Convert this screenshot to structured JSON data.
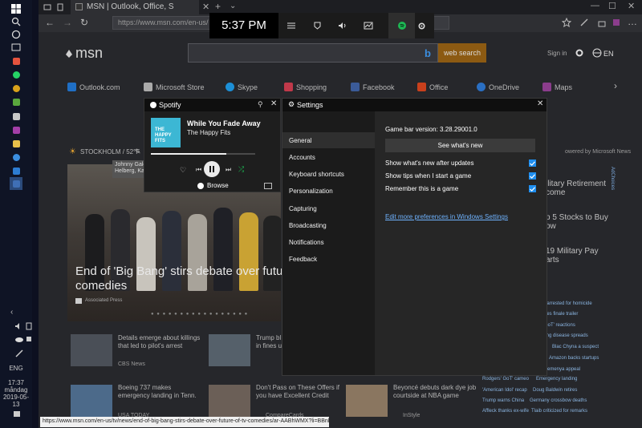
{
  "taskbar": {
    "language": "ENG",
    "time": "17:37",
    "day": "måndag",
    "date": "2019-05-13"
  },
  "browser": {
    "tab_title": "MSN | Outlook, Office, S",
    "address": "https://www.msn.com/en-us/",
    "status_url": "https://www.msn.com/en-us/tv/news/end-of-big-bang-stirs-debate-over-future-of-tv-comedies/ar-AABhWMX?li=BBnb7Kz"
  },
  "msn": {
    "logo": "msn",
    "search_button": "web search",
    "signin": "Sign in",
    "locale": "EN",
    "nav": [
      "Outlook.com",
      "Microsoft Store",
      "Skype",
      "Shopping",
      "Facebook",
      "Office",
      "OneDrive",
      "Maps"
    ],
    "weather": "STOCKHOLM / 52°F",
    "hero_tooltip_1": "Johnny Galeck",
    "hero_tooltip_2": "Helberg, Kal",
    "hero_caption_1": "End of 'Big Bang' stirs debate over futu",
    "hero_caption_2": "comedies",
    "hero_source": "Associated Press",
    "powered_by": "owered by Microsoft News",
    "ad_choices": "AdChoices",
    "right_items": [
      {
        "line1": "ilitary Retirement",
        "line2": "come"
      },
      {
        "line1": "p 5 Stocks to Buy",
        "line2": "ow"
      },
      {
        "line1": "19 Military Pay",
        "line2": "arts"
      }
    ],
    "news": [
      {
        "title1": "Details emerge about killings",
        "title2": "that led to pilot's arrest",
        "source": "CBS News"
      },
      {
        "title1": "Trump bl",
        "title2": "in fines un",
        "source": ""
      },
      {
        "title1": "Boeing 737 makes",
        "title2": "emergency landing in Tenn.",
        "source": "USA TODAY"
      },
      {
        "title1": "Don't Pass on These Offers if",
        "title2": "you have Excellent Credit",
        "source": "CompareCards"
      },
      {
        "title1": "Beyoncé debuts dark dye job",
        "title2": "courtside at NBA game",
        "source": "InStyle"
      }
    ],
    "trending": [
      "t arrested for homicide",
      "ries finale trailer",
      "GoT' reactions",
      "ling disease spreads",
      "Blac Chyna a suspect",
      "Amazon backs startups",
      "Semenya appeal",
      "Rodgers' GoT' cameo",
      "Emergency landing",
      "'American Idol' recap",
      "Doug Baldwin retires",
      "Trump warns China",
      "Germany crossbow deaths",
      "Affleck thanks ex-wife",
      "Tlaib criticized for remarks"
    ]
  },
  "gamebar": {
    "time": "5:37 PM"
  },
  "spotify": {
    "title": "Spotify",
    "track": "While You Fade Away",
    "artist": "The Happy Fits",
    "art_text": "THE HAPPY FITS",
    "browse": "Browse",
    "progress": 0.72
  },
  "settings": {
    "title": "Settings",
    "menu": [
      "General",
      "Accounts",
      "Keyboard shortcuts",
      "Personalization",
      "Capturing",
      "Broadcasting",
      "Notifications",
      "Feedback"
    ],
    "selected": "General",
    "version": "Game bar version: 3.28.29001.0",
    "whats_new_button": "See what's new",
    "options": [
      {
        "label": "Show what's new after updates",
        "checked": true
      },
      {
        "label": "Show tips when I start a game",
        "checked": true
      },
      {
        "label": "Remember this is a game",
        "checked": true
      }
    ],
    "more_link": "Edit more preferences in Windows Settings"
  },
  "colors": {
    "accent": "#1f8ff0",
    "spotify_green": "#1db954",
    "msn_search": "#8c5a12"
  }
}
